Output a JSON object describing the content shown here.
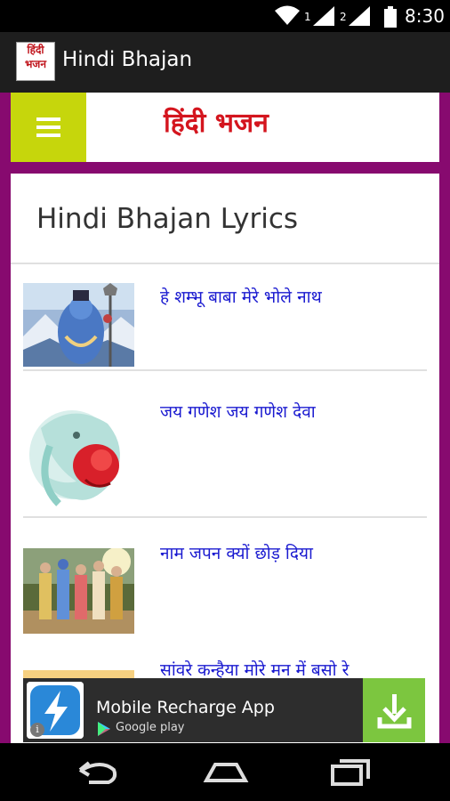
{
  "status_bar": {
    "sim1_label": "1",
    "sim2_label": "2",
    "time": "8:30"
  },
  "app_bar": {
    "title": "Hindi Bhajan",
    "icon_text_line1": "हिंदी",
    "icon_text_line2": "भजन"
  },
  "banner": {
    "title": "हिंदी भजन"
  },
  "content": {
    "heading": "Hindi Bhajan Lyrics",
    "items": [
      {
        "title": "हे शम्भू बाबा मेरे भोले नाथ",
        "thumb": "shiva-image"
      },
      {
        "title": "जय गणेश जय गणेश देवा",
        "thumb": "ganesha-image"
      },
      {
        "title": "नाम जपन क्यों छोड़ दिया",
        "thumb": "kirtan-image"
      },
      {
        "title": "सांवरे कन्हैया मोरे मन में बसो रे",
        "thumb": "krishna-image"
      }
    ]
  },
  "ad": {
    "title": "Mobile Recharge App",
    "store_label": "Google play",
    "info_label": "i",
    "accent_color": "#7cc63f"
  },
  "colors": {
    "background": "#870a6f",
    "menu_button": "#c6d60c",
    "banner_title": "#d4151e",
    "item_title": "#1a1ad0"
  },
  "icons": {
    "menu": "hamburger-menu-icon",
    "download": "download-icon",
    "back": "back-icon",
    "home": "home-icon",
    "recents": "recent-apps-icon"
  }
}
